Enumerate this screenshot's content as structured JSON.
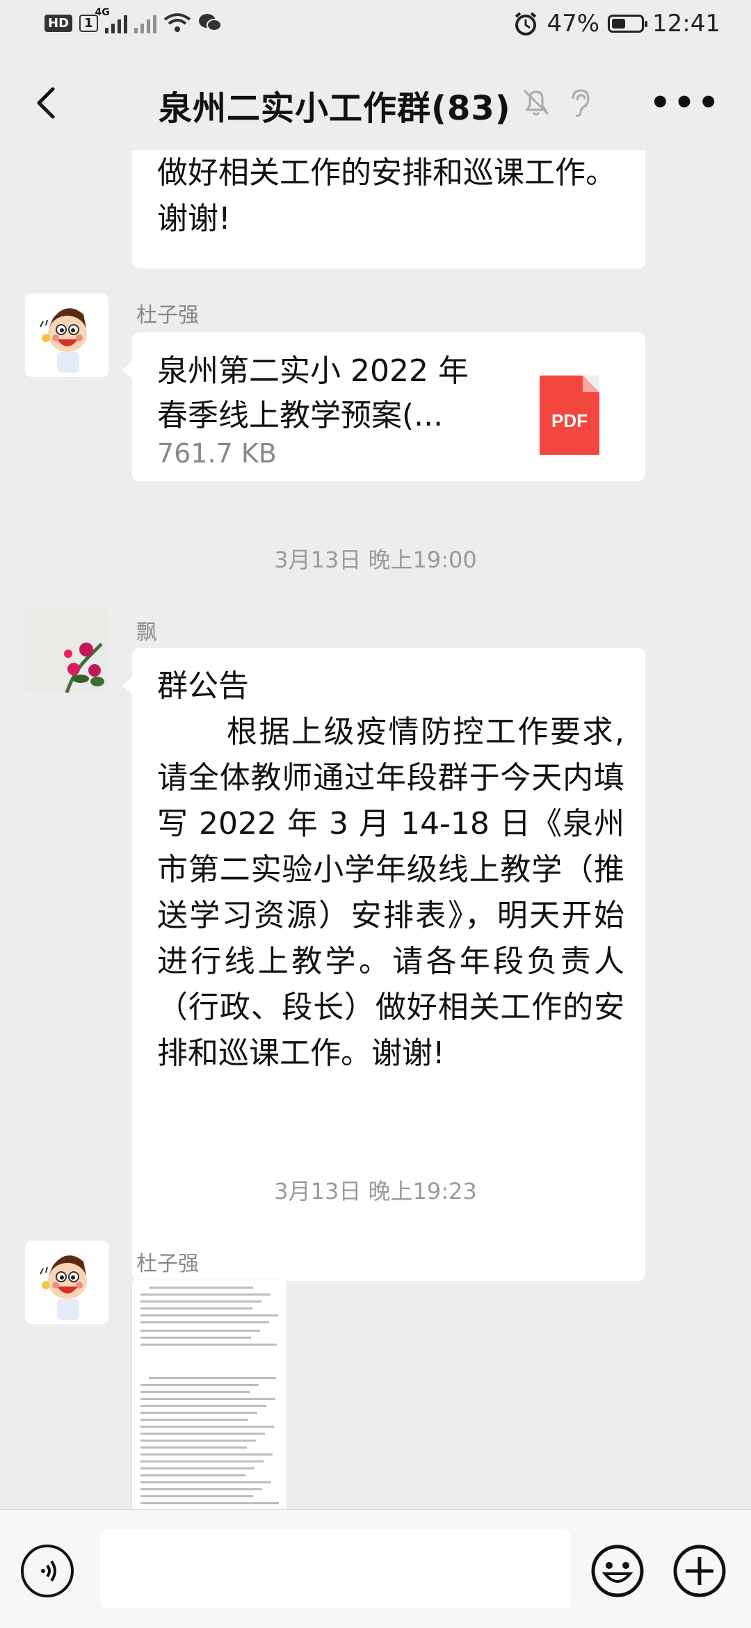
{
  "status": {
    "hd": "HD",
    "sim": "1",
    "net": "4G",
    "alarm_icon": "alarm-icon",
    "battery_percent": "47%",
    "battery_level": 0.47,
    "time": "12:41"
  },
  "header": {
    "title": "泉州二实小工作群",
    "count": "(83)",
    "icons": [
      "back-arrow-icon",
      "mute-bell-icon",
      "ear-icon",
      "more-icon"
    ]
  },
  "messages": {
    "m0_text": "做好相关工作的安排和巡课工作。谢谢!",
    "m1": {
      "sender": "杜子强",
      "file_name_l1": "泉州第二实小 2022 年",
      "file_name_l2": "春季线上教学预案(...",
      "file_size": "761.7 KB",
      "file_type": "PDF"
    },
    "time1": "3月13日 晚上19:00",
    "m2": {
      "sender": "飘",
      "heading": "群公告",
      "body": "根据上级疫情防控工作要求,请全体教师通过年段群于今天内填写 2022 年 3 月 14-18 日《泉州市第二实验小学年级线上教学（推送学习资源）安排表》，明天开始进行线上教学。请各年段负责人（行政、段长）做好相关工作的安排和巡课工作。谢谢!"
    },
    "time2": "3月13日 晚上19:23",
    "m3": {
      "sender": "杜子强"
    }
  },
  "input": {
    "icons": [
      "voice-icon",
      "emoji-icon",
      "plus-icon"
    ]
  }
}
